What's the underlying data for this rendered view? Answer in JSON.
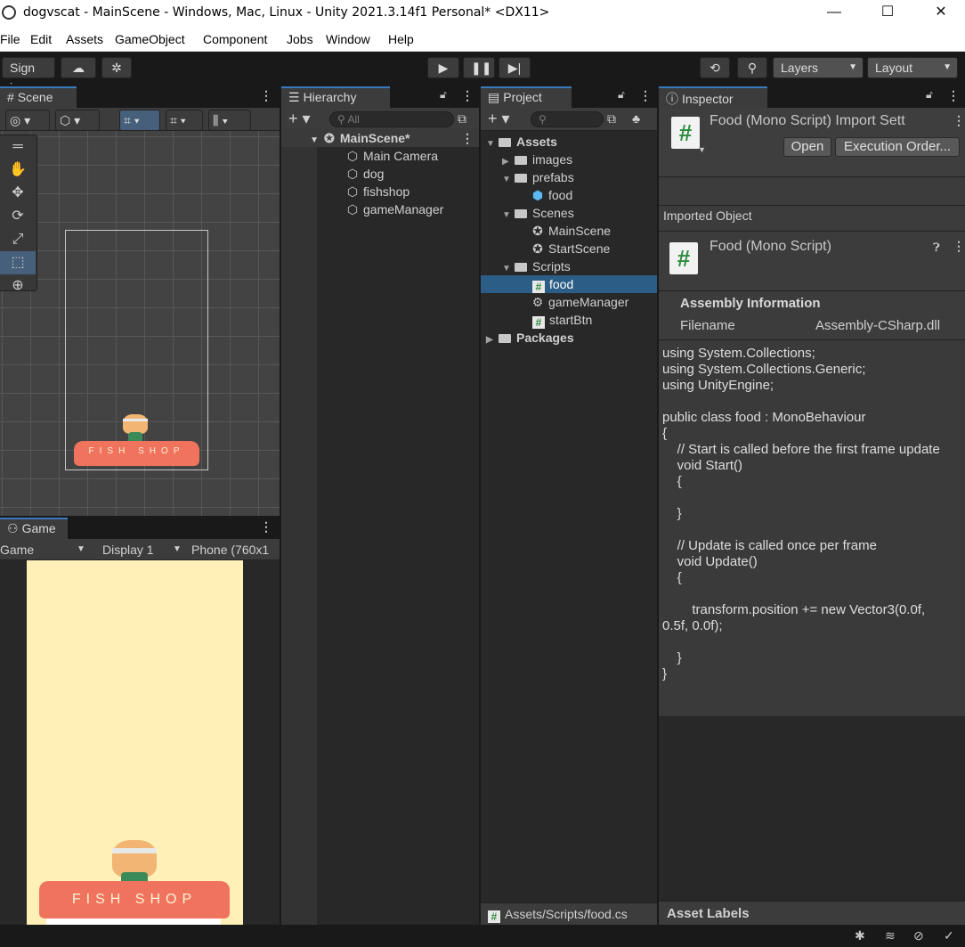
{
  "window": {
    "title": "dogvscat - MainScene - Windows, Mac, Linux - Unity 2021.3.14f1 Personal* <DX11>",
    "minimize": "—",
    "maximize": "☐",
    "close": "✕"
  },
  "menu": [
    "File",
    "Edit",
    "Assets",
    "GameObject",
    "Component",
    "Jobs",
    "Window",
    "Help"
  ],
  "toolbar": {
    "sign_in": "Sign in",
    "layers": "Layers",
    "layout": "Layout"
  },
  "scene": {
    "tab": "Scene"
  },
  "game": {
    "tab": "Game",
    "view_select": "Game",
    "display": "Display 1",
    "resolution": "Phone (760x1"
  },
  "shop_sign": "FISH SHOP",
  "hierarchy": {
    "tab": "Hierarchy",
    "search_placeholder": "All",
    "scene_name": "MainScene*",
    "items": [
      "Main Camera",
      "dog",
      "fishshop",
      "gameManager"
    ]
  },
  "project": {
    "tab": "Project",
    "tree": {
      "assets": "Assets",
      "images": "images",
      "prefabs": "prefabs",
      "food_prefab": "food",
      "scenes": "Scenes",
      "main_scene": "MainScene",
      "start_scene": "StartScene",
      "scripts": "Scripts",
      "food_script": "food",
      "game_manager": "gameManager",
      "start_btn": "startBtn",
      "packages": "Packages"
    },
    "footer_path": "Assets/Scripts/food.cs"
  },
  "inspector": {
    "tab": "Inspector",
    "header_title": "Food (Mono Script) Import Sett",
    "open_button": "Open",
    "execution_order_button": "Execution Order...",
    "imported_object_label": "Imported Object",
    "object_title": "Food (Mono Script)",
    "assembly_info_label": "Assembly Information",
    "filename_label": "Filename",
    "filename_value": "Assembly-CSharp.dll",
    "code": "using System.Collections;\nusing System.Collections.Generic;\nusing UnityEngine;\n\npublic class food : MonoBehaviour\n{\n    // Start is called before the first frame update\n    void Start()\n    {\n\n    }\n\n    // Update is called once per frame\n    void Update()\n    {\n\n        transform.position += new Vector3(0.0f,\n0.5f, 0.0f);\n\n    }\n}",
    "asset_labels": "Asset Labels"
  },
  "colors": {
    "accent": "#3a79bb",
    "selection": "#2c5d87",
    "panel_bg": "#282828",
    "game_bg": "#fff0b8",
    "shop": "#f0735e"
  }
}
